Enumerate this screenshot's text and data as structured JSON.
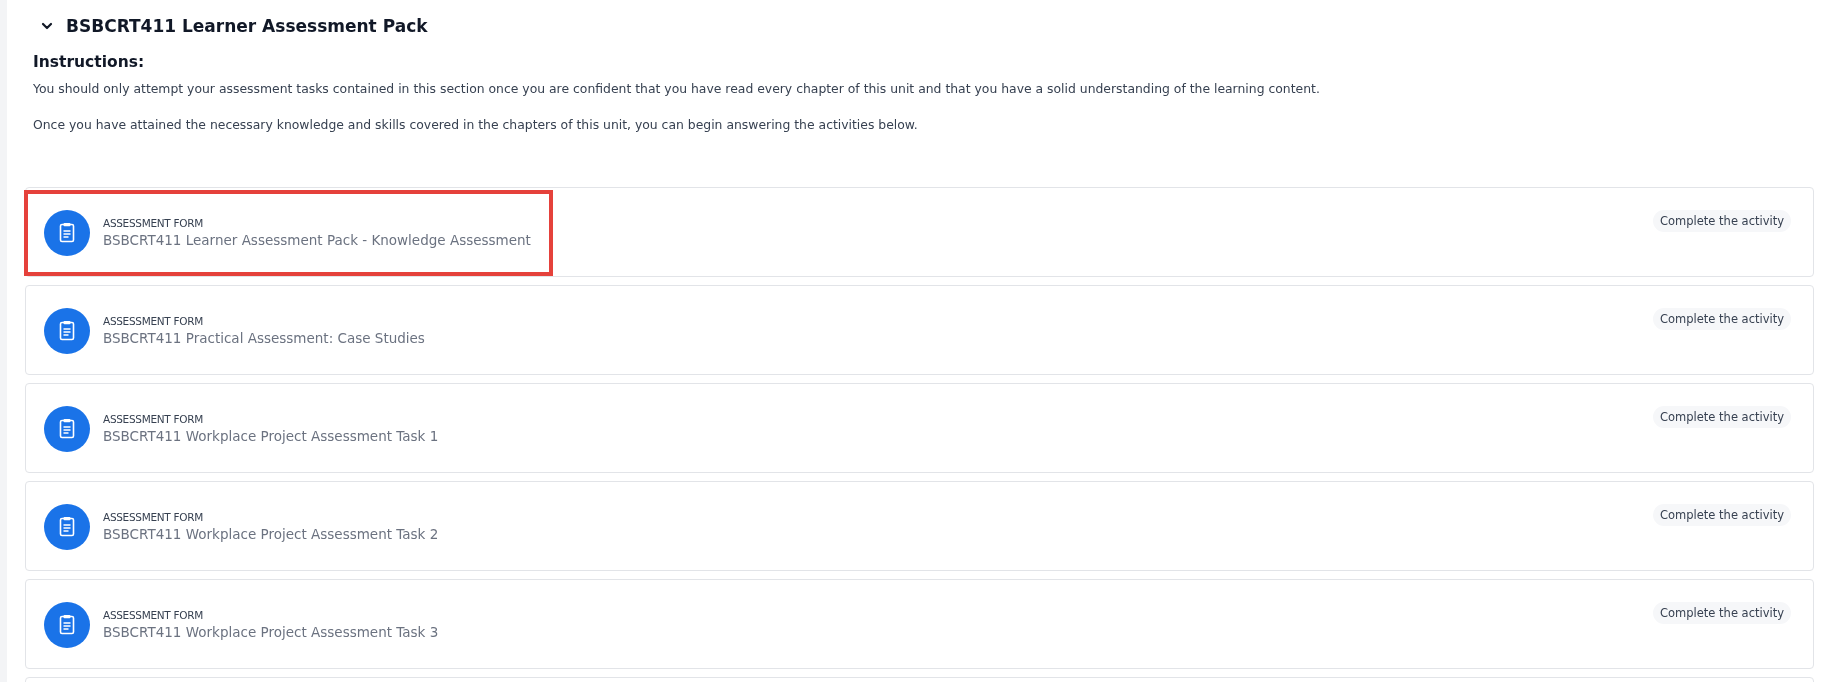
{
  "section": {
    "title": "BSBCRT411 Learner Assessment Pack",
    "expanded": true,
    "instructions_heading": "Instructions:",
    "paragraphs": [
      "You should only attempt your assessment tasks contained in this section once you are confident that you have read every chapter of this unit and that you have a solid understanding of the learning content.",
      "Once you have attained the necessary knowledge and skills covered in the chapters of this unit, you can begin answering the activities below."
    ],
    "activities": [
      {
        "type": "ASSESSMENT FORM",
        "title": "BSBCRT411 Learner Assessment Pack - Knowledge Assessment",
        "status": "Complete the activity",
        "highlighted": true
      },
      {
        "type": "ASSESSMENT FORM",
        "title": "BSBCRT411 Practical Assessment: Case Studies",
        "status": "Complete the activity",
        "highlighted": false
      },
      {
        "type": "ASSESSMENT FORM",
        "title": "BSBCRT411 Workplace Project Assessment Task 1",
        "status": "Complete the activity",
        "highlighted": false
      },
      {
        "type": "ASSESSMENT FORM",
        "title": "BSBCRT411 Workplace Project Assessment Task 2",
        "status": "Complete the activity",
        "highlighted": false
      },
      {
        "type": "ASSESSMENT FORM",
        "title": "BSBCRT411 Workplace Project Assessment Task 3",
        "status": "Complete the activity",
        "highlighted": false
      }
    ]
  }
}
